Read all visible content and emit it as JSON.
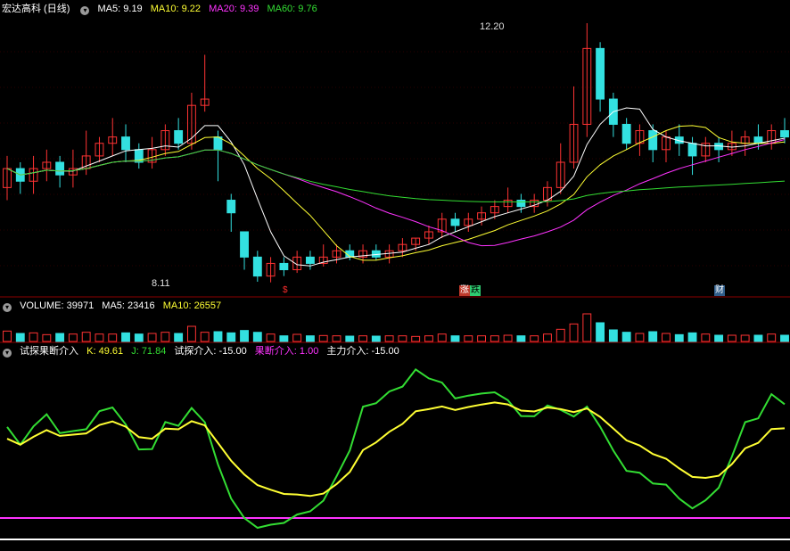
{
  "main": {
    "title": "宏达高科 (日线)",
    "ma": [
      {
        "label": "MA5:",
        "value": "9.19",
        "color": "#ffffff"
      },
      {
        "label": "MA10:",
        "value": "9.22",
        "color": "#ffff33"
      },
      {
        "label": "MA20:",
        "value": "9.39",
        "color": "#ff33ff"
      },
      {
        "label": "MA60:",
        "value": "9.76",
        "color": "#33dd33"
      }
    ],
    "high_label": "12.20",
    "low_label": "8.11",
    "events": [
      {
        "text": "$",
        "color": "#ff2d2d",
        "bg": "transparent"
      },
      {
        "text": "涨",
        "color": "#ffffff",
        "bg": "#c0392b"
      },
      {
        "text": "跌",
        "color": "#000000",
        "bg": "#2ecc71"
      },
      {
        "text": "财",
        "color": "#ffffff",
        "bg": "#2f5d8a"
      }
    ]
  },
  "volume": {
    "label": "VOLUME:",
    "value": "39971",
    "ma5_label": "MA5:",
    "ma5_value": "23416",
    "ma10_label": "MA10:",
    "ma10_value": "26557"
  },
  "indicator": {
    "name": "试探果断介入",
    "k_label": "K:",
    "k_value": "49.61",
    "j_label": "J:",
    "j_value": "71.84",
    "probe_label": "试探介入:",
    "probe_value": "-15.00",
    "decisive_label": "果断介入:",
    "decisive_value": "1.00",
    "main_label": "主力介入:",
    "main_value": "-15.00"
  },
  "colors": {
    "up": "#ff3333",
    "down": "#33e0e0",
    "ma5": "#ffffff",
    "ma10": "#ffff33",
    "ma20": "#ff33ff",
    "ma60": "#33dd33",
    "k": "#ffff33",
    "j": "#33dd33",
    "grid": "#8b0000",
    "magenta": "#ff33ff"
  },
  "chart_data": {
    "type": "candlestick",
    "y_range": [
      8.11,
      12.2
    ],
    "candles": [
      [
        9.6,
        9.9,
        10.1,
        9.4
      ],
      [
        9.9,
        9.7,
        10.0,
        9.5
      ],
      [
        9.7,
        9.9,
        10.1,
        9.5
      ],
      [
        9.9,
        10.0,
        10.2,
        9.7
      ],
      [
        10.0,
        9.8,
        10.1,
        9.6
      ],
      [
        9.8,
        9.9,
        10.2,
        9.6
      ],
      [
        9.9,
        10.1,
        10.5,
        9.8
      ],
      [
        10.1,
        10.3,
        10.4,
        10.0
      ],
      [
        10.3,
        10.4,
        10.7,
        10.1
      ],
      [
        10.4,
        10.2,
        10.6,
        10.0
      ],
      [
        10.2,
        10.0,
        10.3,
        9.9
      ],
      [
        10.0,
        10.2,
        10.4,
        9.9
      ],
      [
        10.2,
        10.5,
        10.6,
        10.1
      ],
      [
        10.5,
        10.3,
        10.7,
        10.2
      ],
      [
        10.3,
        10.9,
        11.1,
        10.2
      ],
      [
        10.9,
        11.0,
        11.7,
        10.8
      ],
      [
        10.4,
        10.2,
        10.5,
        9.7
      ],
      [
        9.4,
        9.2,
        9.5,
        8.9
      ],
      [
        8.9,
        8.5,
        8.9,
        8.3
      ],
      [
        8.5,
        8.2,
        8.6,
        8.11
      ],
      [
        8.2,
        8.4,
        8.5,
        8.1
      ],
      [
        8.4,
        8.3,
        8.5,
        8.2
      ],
      [
        8.3,
        8.5,
        8.6,
        8.25
      ],
      [
        8.5,
        8.4,
        8.6,
        8.3
      ],
      [
        8.4,
        8.5,
        8.7,
        8.35
      ],
      [
        8.5,
        8.6,
        8.7,
        8.4
      ],
      [
        8.6,
        8.5,
        8.7,
        8.45
      ],
      [
        8.5,
        8.6,
        8.7,
        8.4
      ],
      [
        8.6,
        8.5,
        8.7,
        8.45
      ],
      [
        8.5,
        8.6,
        8.7,
        8.4
      ],
      [
        8.6,
        8.7,
        8.8,
        8.5
      ],
      [
        8.7,
        8.8,
        8.8,
        8.6
      ],
      [
        8.8,
        8.9,
        9.0,
        8.7
      ],
      [
        8.9,
        9.1,
        9.2,
        8.8
      ],
      [
        9.1,
        9.0,
        9.2,
        8.9
      ],
      [
        9.0,
        9.1,
        9.2,
        8.9
      ],
      [
        9.1,
        9.2,
        9.3,
        9.0
      ],
      [
        9.2,
        9.3,
        9.4,
        9.1
      ],
      [
        9.3,
        9.4,
        9.6,
        9.2
      ],
      [
        9.4,
        9.3,
        9.5,
        9.2
      ],
      [
        9.3,
        9.4,
        9.5,
        9.2
      ],
      [
        9.4,
        9.6,
        9.7,
        9.3
      ],
      [
        9.6,
        10.0,
        10.3,
        9.5
      ],
      [
        10.0,
        10.6,
        11.2,
        9.9
      ],
      [
        10.6,
        11.8,
        12.2,
        10.4
      ],
      [
        11.8,
        11.0,
        11.9,
        10.8
      ],
      [
        11.0,
        10.6,
        11.1,
        10.4
      ],
      [
        10.6,
        10.3,
        10.7,
        10.2
      ],
      [
        10.3,
        10.5,
        10.6,
        10.1
      ],
      [
        10.5,
        10.2,
        10.6,
        10.0
      ],
      [
        10.2,
        10.4,
        10.5,
        10.0
      ],
      [
        10.4,
        10.3,
        10.6,
        10.1
      ],
      [
        10.3,
        10.1,
        10.4,
        9.8
      ],
      [
        10.1,
        10.3,
        10.4,
        10.0
      ],
      [
        10.3,
        10.2,
        10.4,
        10.0
      ],
      [
        10.2,
        10.3,
        10.5,
        10.1
      ],
      [
        10.3,
        10.4,
        10.5,
        10.1
      ],
      [
        10.4,
        10.3,
        10.6,
        10.2
      ],
      [
        10.3,
        10.5,
        10.6,
        10.2
      ],
      [
        10.5,
        10.4,
        10.7,
        10.3
      ]
    ]
  }
}
